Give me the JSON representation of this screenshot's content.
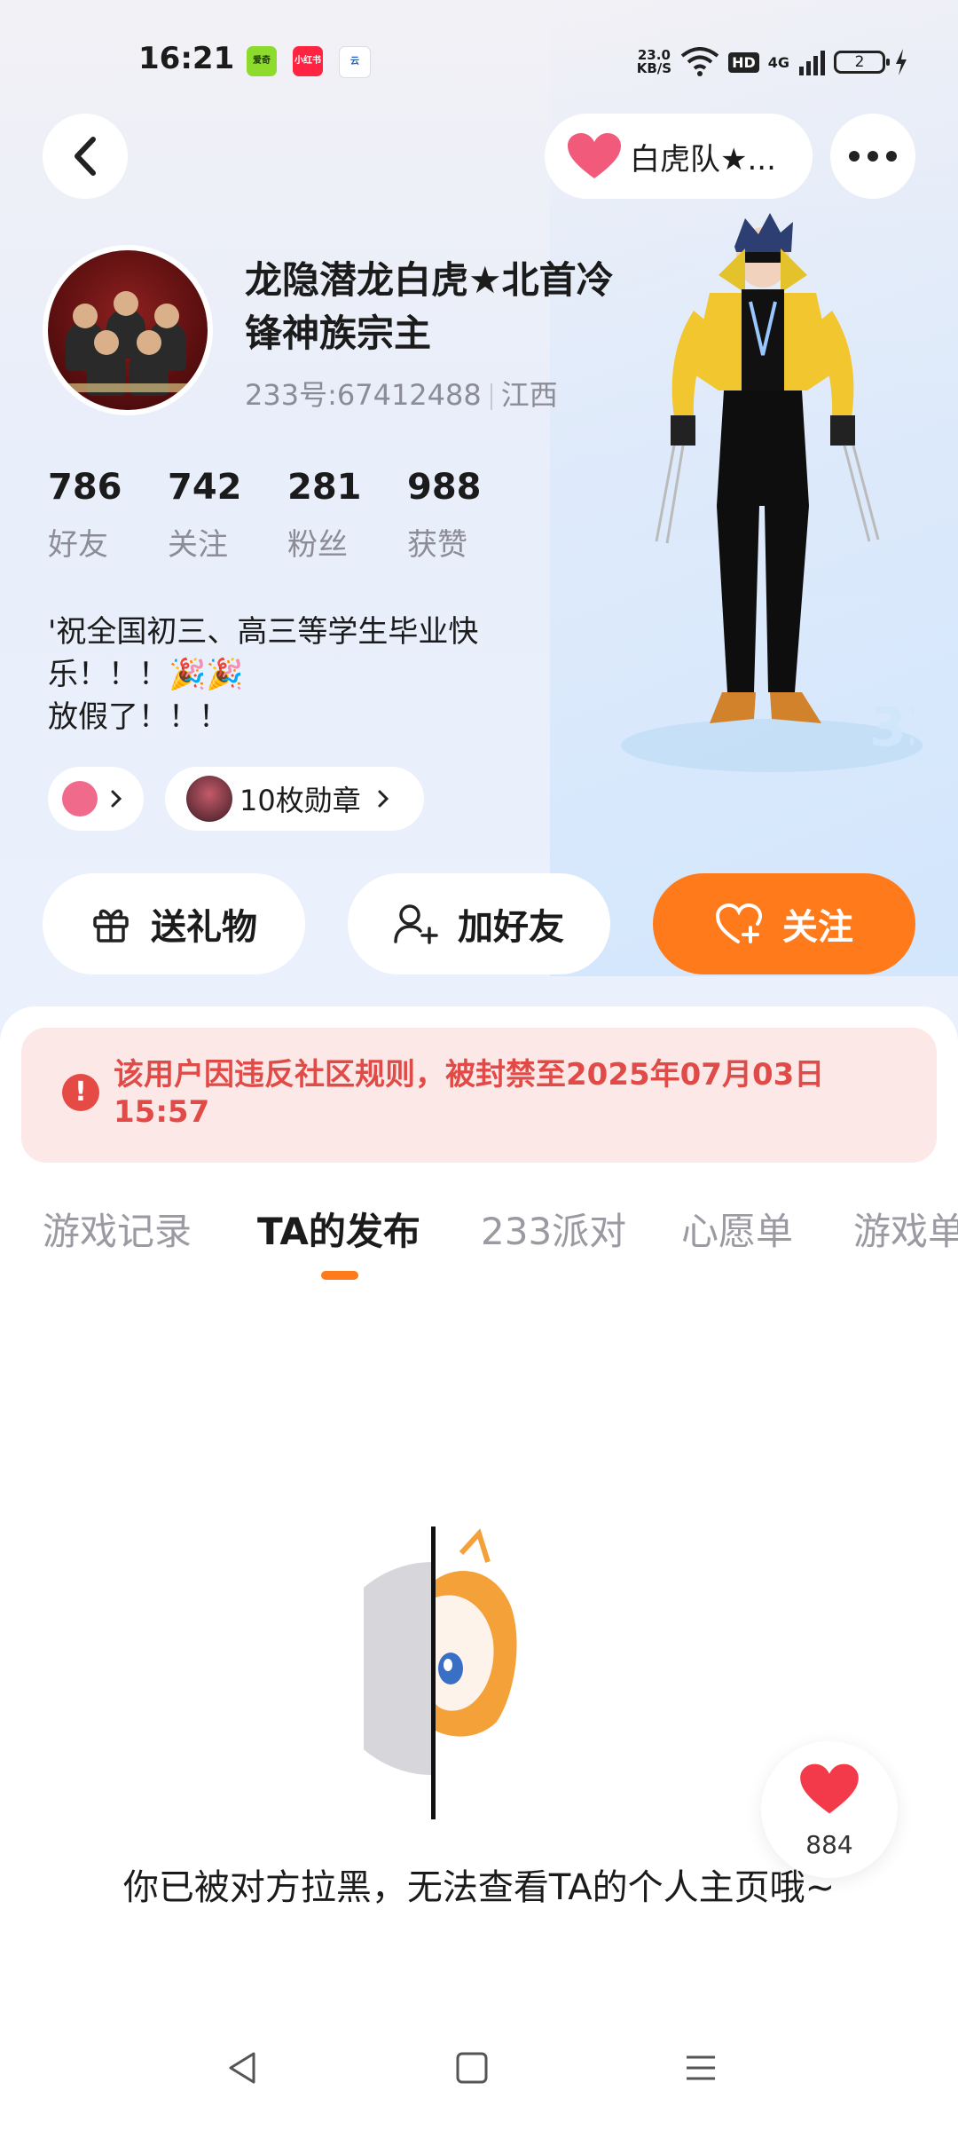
{
  "status_bar": {
    "time": "16:21",
    "apps": [
      {
        "name": "aiqiyi-icon",
        "label": "爱奇",
        "color": "#8ddb2c"
      },
      {
        "name": "xiaohongshu-icon",
        "label": "小红书",
        "color": "#ff2442"
      },
      {
        "name": "app-icon",
        "label": "云",
        "color": "#ffffff"
      }
    ],
    "net_speed_value": "23.0",
    "net_speed_unit": "KB/S",
    "network": "4G",
    "hd": "HD",
    "battery": "2"
  },
  "header": {
    "team_label": "白虎队★..."
  },
  "profile": {
    "name_line1": "龙隐潜龙白虎★北首冷",
    "name_line2": "锋神族宗主",
    "uid": "233号:67412488",
    "region": "江西"
  },
  "stats": [
    {
      "value": "786",
      "label": "好友"
    },
    {
      "value": "742",
      "label": "关注"
    },
    {
      "value": "281",
      "label": "粉丝"
    },
    {
      "value": "988",
      "label": "获赞"
    }
  ],
  "bio": {
    "line1": "'祝全国初三、高三等学生毕业快",
    "line2": "乐！！！🎉🎉",
    "line3": "放假了！！！"
  },
  "chips": {
    "badge_count": "10枚勋章"
  },
  "actions": {
    "gift": "送礼物",
    "add_friend": "加好友",
    "follow": "关注"
  },
  "ban_notice": {
    "line1": "该用户因违反社区规则，被封禁至2025年07月03日",
    "line2": "15:57"
  },
  "tabs": [
    "游戏记录",
    "TA的发布",
    "233派对",
    "心愿单",
    "游戏单"
  ],
  "active_tab": "TA的发布",
  "blocked_message": "你已被对方拉黑，无法查看TA的个人主页哦~",
  "like_count": "884",
  "colors": {
    "accent": "#ff7a1a",
    "ban_text": "#e14b47",
    "ban_bg": "#fde8e8"
  }
}
